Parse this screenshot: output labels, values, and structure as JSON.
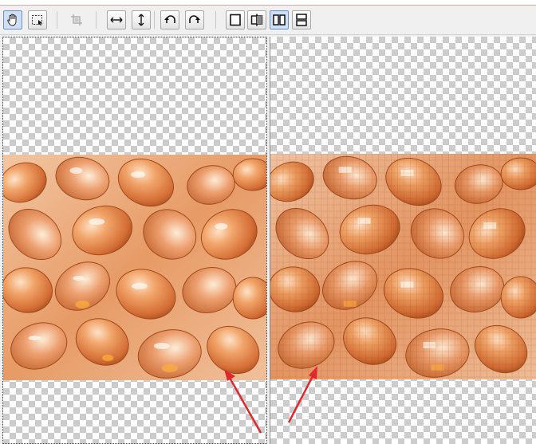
{
  "toolbar": {
    "buttons": [
      {
        "name": "hand-tool-button",
        "icon": "hand-icon",
        "state": "pressed"
      },
      {
        "name": "select-tool-button",
        "icon": "dashed-selection-icon",
        "state": "raised"
      },
      {
        "name": "crop-button",
        "icon": "crop-icon",
        "state": "disabled"
      },
      {
        "name": "flip-horizontal-button",
        "icon": "horizontal-arrows-icon",
        "state": "raised"
      },
      {
        "name": "flip-vertical-button",
        "icon": "vertical-arrows-icon",
        "state": "raised"
      },
      {
        "name": "rotate-left-button",
        "icon": "rotate-left-icon",
        "state": "raised"
      },
      {
        "name": "rotate-right-button",
        "icon": "rotate-right-icon",
        "state": "raised"
      },
      {
        "name": "single-view-button",
        "icon": "single-pane-icon",
        "state": "raised"
      },
      {
        "name": "split-compare-button",
        "icon": "split-compare-icon",
        "state": "raised"
      },
      {
        "name": "side-by-side-button",
        "icon": "side-by-side-icon",
        "state": "pressed"
      },
      {
        "name": "top-bottom-button",
        "icon": "top-bottom-icon",
        "state": "raised"
      }
    ]
  },
  "colors": {
    "arrow": "#e0282d",
    "checker_dark": "#cccccc",
    "checker_light": "#ffffff",
    "capsule_base": "#e8935a",
    "capsule_dark": "#b8521f",
    "capsule_highlight": "#ffe3c8"
  },
  "panes": {
    "left": {
      "label": "original-image",
      "quality": "smooth"
    },
    "right": {
      "label": "compressed-image",
      "quality": "blocky"
    }
  }
}
